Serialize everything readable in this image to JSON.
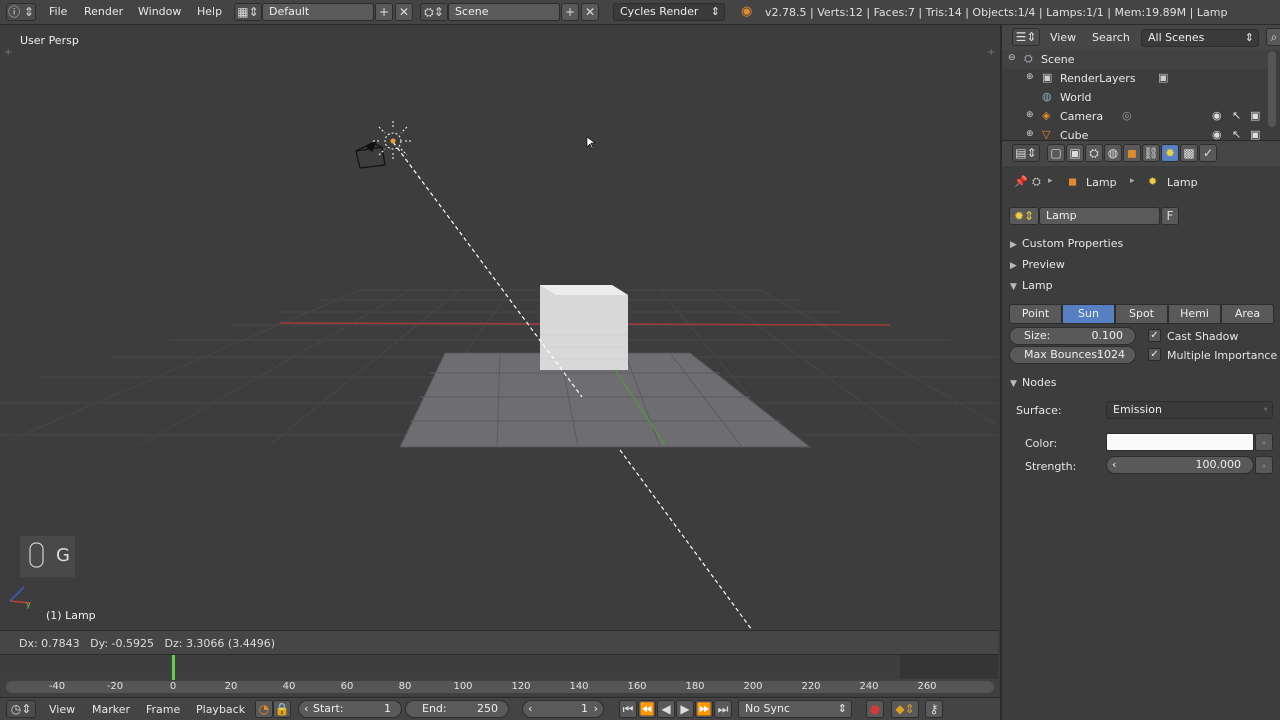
{
  "topbar": {
    "menus": [
      "File",
      "Render",
      "Window",
      "Help"
    ],
    "layout_name": "Default",
    "scene_name": "Scene",
    "render_engine": "Cycles Render",
    "stats": "v2.78.5 | Verts:12 | Faces:7 | Tris:14 | Objects:1/4 | Lamps:1/1 | Mem:19.89M | Lamp"
  },
  "viewport": {
    "view_label": "User Persp",
    "object_label": "(1) Lamp",
    "key_hint": "G"
  },
  "deltas": "Dx: 0.7843   Dy: -0.5925   Dz: 3.3066 (3.4496)",
  "timeline": {
    "ticks": [
      {
        "label": "-40",
        "value": -40
      },
      {
        "label": "-20",
        "value": -20
      },
      {
        "label": "0",
        "value": 0
      },
      {
        "label": "20",
        "value": 20
      },
      {
        "label": "40",
        "value": 40
      },
      {
        "label": "60",
        "value": 60
      },
      {
        "label": "80",
        "value": 80
      },
      {
        "label": "100",
        "value": 100
      },
      {
        "label": "120",
        "value": 120
      },
      {
        "label": "140",
        "value": 140
      },
      {
        "label": "160",
        "value": 160
      },
      {
        "label": "180",
        "value": 180
      },
      {
        "label": "200",
        "value": 200
      },
      {
        "label": "220",
        "value": 220
      },
      {
        "label": "240",
        "value": 240
      },
      {
        "label": "260",
        "value": 260
      }
    ],
    "current_frame_value": 0
  },
  "timeline_header": {
    "menus": [
      "View",
      "Marker",
      "Frame",
      "Playback"
    ],
    "start_label": "Start:",
    "start_value": "1",
    "end_label": "End:",
    "end_value": "250",
    "current_frame": "1",
    "sync": "No Sync"
  },
  "outliner": {
    "menus": [
      "View",
      "Search"
    ],
    "filter": "All Scenes",
    "items": [
      {
        "label": "Scene",
        "icon": "scene-icon"
      },
      {
        "label": "RenderLayers",
        "icon": "renderlayers-icon"
      },
      {
        "label": "World",
        "icon": "world-icon"
      },
      {
        "label": "Camera",
        "icon": "camera-icon"
      },
      {
        "label": "Cube",
        "icon": "mesh-icon"
      }
    ]
  },
  "properties": {
    "breadcrumb": [
      "Lamp",
      "Lamp"
    ],
    "datablock_name": "Lamp",
    "fake_user": "F",
    "panels": {
      "custom_properties": "Custom Properties",
      "preview": "Preview",
      "lamp": "Lamp",
      "nodes": "Nodes"
    },
    "lamp_types": [
      "Point",
      "Sun",
      "Spot",
      "Hemi",
      "Area"
    ],
    "active_lamp_type": "Sun",
    "size_label": "Size:",
    "size_value": "0.100",
    "bounces_label": "Max Bounces:",
    "bounces_value": "1024",
    "cast_shadow": "Cast Shadow",
    "multiple_importance": "Multiple Importance",
    "surface_label": "Surface:",
    "surface_value": "Emission",
    "color_label": "Color:",
    "strength_label": "Strength:",
    "strength_value": "100.000"
  },
  "colors": {
    "accent": "#5680c2",
    "x_axis": "#a33b3b",
    "y_axis": "#4f9a3a",
    "playhead": "#5fd14a",
    "record": "#d23a3a"
  }
}
